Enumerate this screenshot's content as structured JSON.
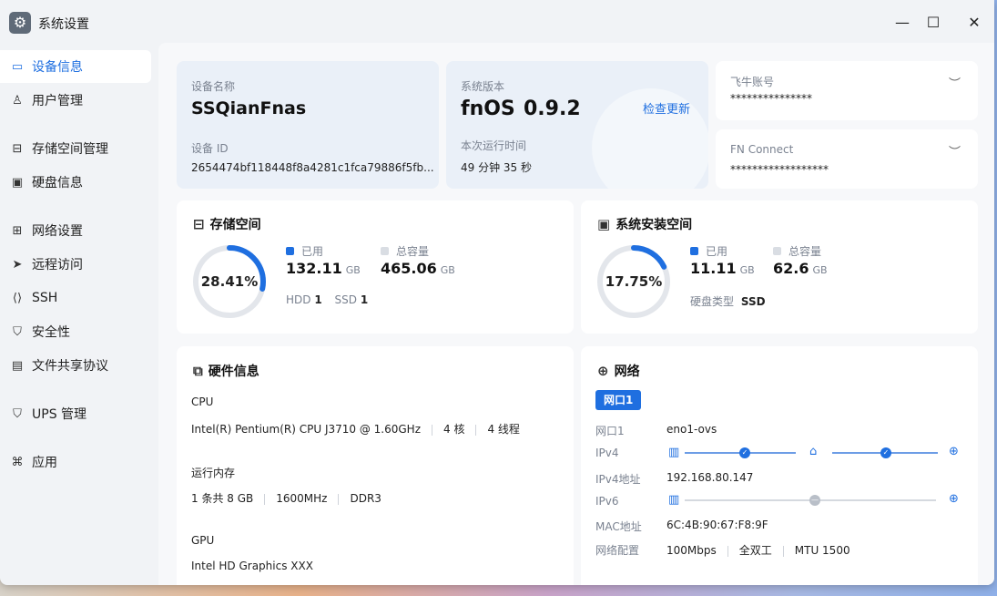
{
  "window": {
    "title": "系统设置"
  },
  "sidebar": {
    "items": [
      {
        "label": "设备信息",
        "icon": "device-icon"
      },
      {
        "label": "用户管理",
        "icon": "user-icon"
      },
      {
        "label": "存储空间管理",
        "icon": "storage-icon"
      },
      {
        "label": "硬盘信息",
        "icon": "disk-icon"
      },
      {
        "label": "网络设置",
        "icon": "network-icon"
      },
      {
        "label": "远程访问",
        "icon": "remote-icon"
      },
      {
        "label": "SSH",
        "icon": "terminal-icon"
      },
      {
        "label": "安全性",
        "icon": "shield-icon"
      },
      {
        "label": "文件共享协议",
        "icon": "file-icon"
      },
      {
        "label": "UPS 管理",
        "icon": "ups-icon"
      },
      {
        "label": "应用",
        "icon": "apps-icon"
      }
    ]
  },
  "device": {
    "name_label": "设备名称",
    "name": "SSQianFnas",
    "id_label": "设备 ID",
    "id": "2654474bf118448f8a4281c1fca79886f5fb..."
  },
  "system": {
    "version_label": "系统版本",
    "os": "fnOS",
    "version": "0.9.2",
    "check_update": "检查更新",
    "uptime_label": "本次运行时间",
    "uptime": "49 分钟 35 秒"
  },
  "accounts": {
    "feishu_label": "飞牛账号",
    "feishu_value": "***************",
    "fnconnect_label": "FN Connect",
    "fnconnect_value": "******************"
  },
  "storage": {
    "title": "存储空间",
    "percent_text": "28.41%",
    "percent": 28.41,
    "used_label": "已用",
    "used": "132.11",
    "used_unit": "GB",
    "total_label": "总容量",
    "total": "465.06",
    "total_unit": "GB",
    "hdd_label": "HDD",
    "hdd": "1",
    "ssd_label": "SSD",
    "ssd": "1"
  },
  "sysdisk": {
    "title": "系统安装空间",
    "percent_text": "17.75%",
    "percent": 17.75,
    "used_label": "已用",
    "used": "11.11",
    "used_unit": "GB",
    "total_label": "总容量",
    "total": "62.6",
    "total_unit": "GB",
    "type_label": "硬盘类型",
    "type": "SSD"
  },
  "hardware": {
    "title": "硬件信息",
    "cpu_label": "CPU",
    "cpu_model": "Intel(R) Pentium(R) CPU J3710 @ 1.60GHz",
    "cpu_cores": "4 核",
    "cpu_threads": "4 线程",
    "mem_label": "运行内存",
    "mem_size": "1 条共 8 GB",
    "mem_freq": "1600MHz",
    "mem_type": "DDR3",
    "gpu_label": "GPU",
    "gpu_model": "Intel HD Graphics XXX"
  },
  "network": {
    "title": "网络",
    "tab": "网口1",
    "port_label": "网口1",
    "port": "eno1-ovs",
    "ipv4_label": "IPv4",
    "ipv4_addr_label": "IPv4地址",
    "ipv4_addr": "192.168.80.147",
    "ipv6_label": "IPv6",
    "mac_label": "MAC地址",
    "mac": "6C:4B:90:67:F8:9F",
    "config_label": "网络配置",
    "speed": "100Mbps",
    "duplex": "全双工",
    "mtu": "MTU 1500"
  },
  "colors": {
    "accent": "#1f6fe0",
    "ring_track": "#e3e6eb",
    "total_square": "#d9dde3"
  }
}
